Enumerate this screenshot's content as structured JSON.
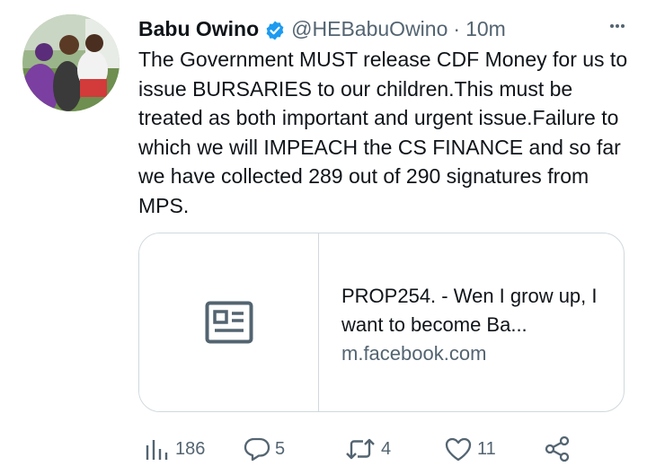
{
  "tweet": {
    "author": {
      "display_name": "Babu Owino",
      "handle": "@HEBabuOwino",
      "verified": true
    },
    "separator": "·",
    "time": "10m",
    "text": "The Government MUST release CDF Money for us to issue BURSARIES to our children.This must be treated as both important and urgent issue.Failure to which we will IMPEACH the CS FINANCE and so far we have collected 289 out of 290 signatures from MPS.",
    "link_card": {
      "title": "PROP254. - Wen I grow up, I want to become Ba...",
      "domain": "m.facebook.com"
    },
    "actions": {
      "views": "186",
      "replies": "5",
      "retweets": "4",
      "likes": "11"
    }
  },
  "colors": {
    "text_primary": "#0f1419",
    "text_secondary": "#536471",
    "verified_blue": "#1d9bf0",
    "card_border": "#cfd9de"
  }
}
